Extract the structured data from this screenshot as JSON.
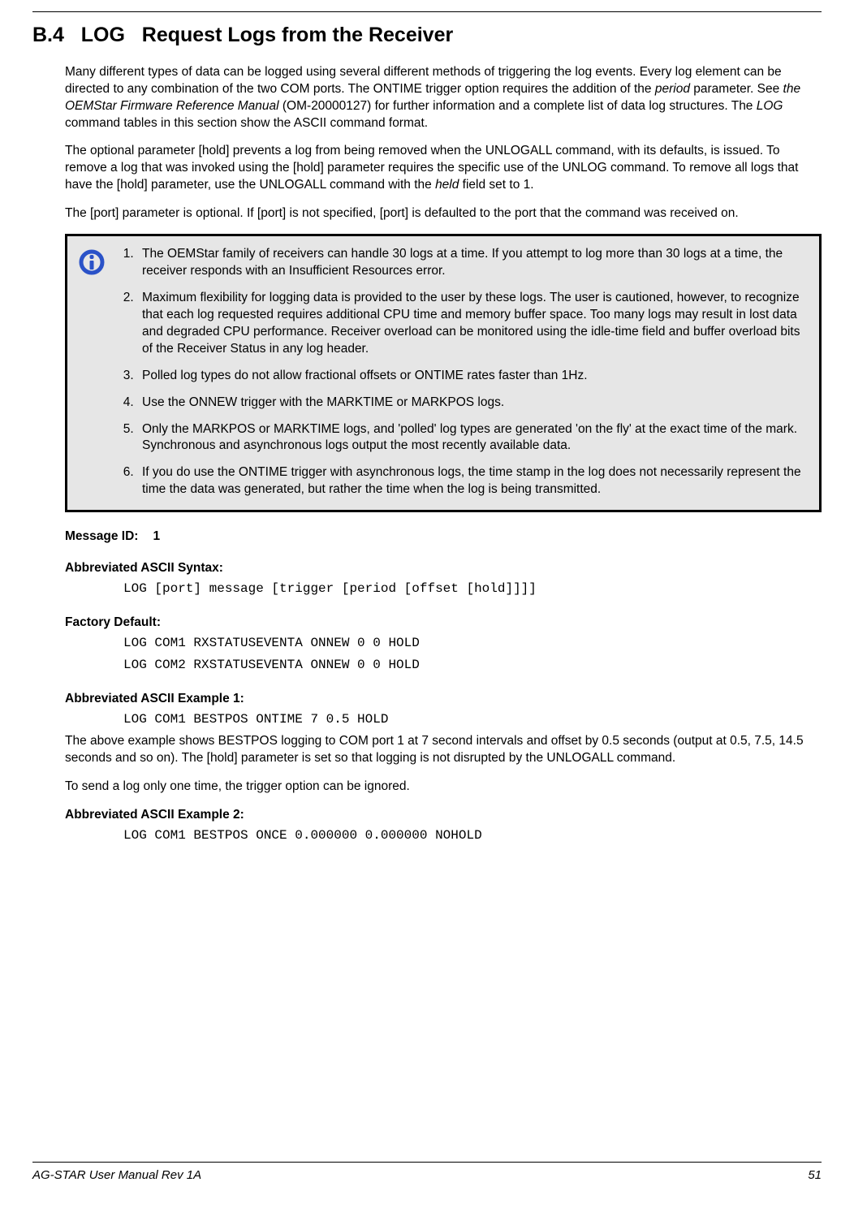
{
  "header": {
    "section_number": "B.4",
    "section_cmd": "LOG",
    "section_desc": "Request Logs from the Receiver"
  },
  "paragraphs": {
    "p1_a": "Many different types of data can be logged using several different methods of triggering the log events. Every log element can be directed to any combination of the two COM ports. The ONTIME trigger option requires the addition of the ",
    "p1_b": "period",
    "p1_c": " parameter. See ",
    "p1_d": "the OEMStar Firmware Reference Manual",
    "p1_e": " (OM-20000127) for further information and a complete list of data log structures. The ",
    "p1_f": "LOG",
    "p1_g": " command tables in this section show the ASCII command format.",
    "p2_a": "The optional parameter [hold] prevents a log from being removed when the UNLOGALL command, with its defaults, is issued. To remove a log that was invoked using the [hold] parameter requires the specific use of the UNLOG command. To remove all logs that have the [hold] parameter, use the UNLOGALL command with the ",
    "p2_b": "held",
    "p2_c": " field set to 1.",
    "p3": "The [port] parameter is optional. If [port] is not specified, [port] is defaulted to the port that the command was received on."
  },
  "info_notes": {
    "n1": "The OEMStar family of receivers can handle 30 logs at a time. If you attempt to log more than 30 logs at a time, the receiver responds with an Insufficient Resources error.",
    "n2": "Maximum flexibility for logging data is provided to the user by these logs. The user is cautioned, however, to recognize that each log requested requires additional CPU time and memory buffer space. Too many logs may result in lost data and degraded CPU performance. Receiver overload can be monitored using the idle-time field and buffer overload bits of the Receiver Status in any log header.",
    "n3": "Polled log types do not allow fractional offsets or ONTIME rates faster than 1Hz.",
    "n4": "Use the ONNEW trigger with the MARKTIME or MARKPOS logs.",
    "n5": "Only the MARKPOS or MARKTIME logs, and 'polled' log types are generated 'on the fly' at the exact time of the mark. Synchronous and asynchronous logs output the most recently available data.",
    "n6": "If you do use the ONTIME trigger with asynchronous logs, the time stamp in the log does not necessarily represent the time the data was generated, but rather the time when the log is being transmitted."
  },
  "fields": {
    "msgid_label": "Message ID:",
    "msgid_value": "1",
    "syntax_label": "Abbreviated ASCII Syntax:",
    "syntax_value": "LOG [port] message [trigger [period [offset [hold]]]]",
    "default_label": "Factory Default:",
    "default_v1": "LOG COM1 RXSTATUSEVENTA ONNEW 0 0 HOLD",
    "default_v2": "LOG COM2 RXSTATUSEVENTA ONNEW 0 0 HOLD",
    "ex1_label": "Abbreviated ASCII Example 1:",
    "ex1_value": "LOG COM1 BESTPOS ONTIME 7 0.5 HOLD",
    "ex1_desc": "The above example shows BESTPOS logging to COM port 1 at 7 second intervals and offset by 0.5 seconds (output at 0.5, 7.5, 14.5 seconds and so on). The [hold] parameter is set so that logging is not disrupted by the UNLOGALL command.",
    "ex1_desc2": "To send a log only one time, the trigger option can be ignored.",
    "ex2_label": "Abbreviated ASCII Example 2:",
    "ex2_value": "LOG COM1 BESTPOS ONCE 0.000000 0.000000 NOHOLD"
  },
  "footer": {
    "left": "AG-STAR User Manual Rev 1A",
    "right": "51"
  }
}
